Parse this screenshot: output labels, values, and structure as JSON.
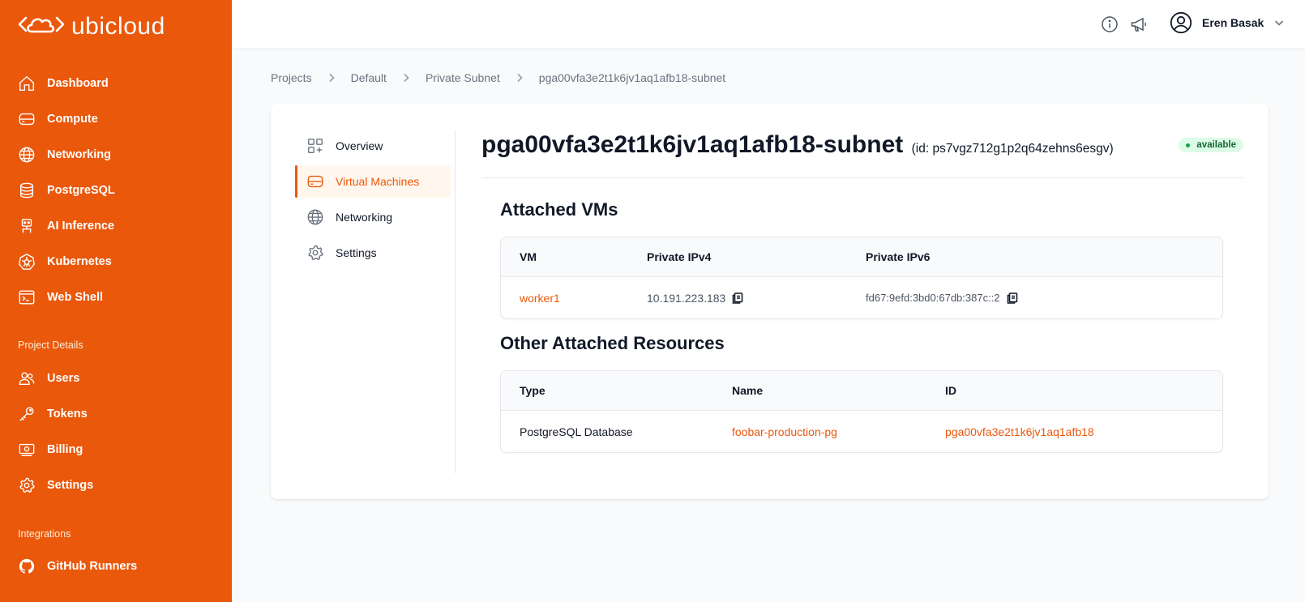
{
  "app": {
    "brand": "ubicloud",
    "accent_color": "#ea580c"
  },
  "sidebar": {
    "items": [
      {
        "label": "Dashboard",
        "icon": "home-icon"
      },
      {
        "label": "Compute",
        "icon": "server-icon"
      },
      {
        "label": "Networking",
        "icon": "globe-icon"
      },
      {
        "label": "PostgreSQL",
        "icon": "database-icon"
      },
      {
        "label": "AI Inference",
        "icon": "robot-icon"
      },
      {
        "label": "Kubernetes",
        "icon": "kubernetes-icon"
      },
      {
        "label": "Web Shell",
        "icon": "terminal-icon"
      }
    ],
    "project_section": "Project Details",
    "project_items": [
      {
        "label": "Users",
        "icon": "users-icon"
      },
      {
        "label": "Tokens",
        "icon": "key-icon"
      },
      {
        "label": "Billing",
        "icon": "billing-icon"
      },
      {
        "label": "Settings",
        "icon": "gear-icon"
      }
    ],
    "integrations_section": "Integrations",
    "integration_items": [
      {
        "label": "GitHub Runners",
        "icon": "github-icon"
      }
    ]
  },
  "topbar": {
    "user_name": "Eren Basak"
  },
  "breadcrumb": [
    "Projects",
    "Default",
    "Private Subnet",
    "pga00vfa3e2t1k6jv1aq1afb18-subnet"
  ],
  "sub_nav": [
    {
      "label": "Overview",
      "icon": "overview-icon",
      "active": false
    },
    {
      "label": "Virtual Machines",
      "icon": "server-icon",
      "active": true
    },
    {
      "label": "Networking",
      "icon": "globe-icon",
      "active": false
    },
    {
      "label": "Settings",
      "icon": "gear-icon",
      "active": false
    }
  ],
  "page": {
    "title": "pga00vfa3e2t1k6jv1aq1afb18-subnet",
    "id_text": "(id: ps7vgz712g1p2q64zehns6esgv)",
    "status": "available",
    "status_color": "#16a34a"
  },
  "attached_vms": {
    "title": "Attached VMs",
    "columns": [
      "VM",
      "Private IPv4",
      "Private IPv6"
    ],
    "rows": [
      {
        "vm": "worker1",
        "ipv4": "10.191.223.183",
        "ipv6": "fd67:9efd:3bd0:67db:387c::2"
      }
    ]
  },
  "other_resources": {
    "title": "Other Attached Resources",
    "columns": [
      "Type",
      "Name",
      "ID"
    ],
    "rows": [
      {
        "type": "PostgreSQL Database",
        "name": "foobar-production-pg",
        "id": "pga00vfa3e2t1k6jv1aq1afb18"
      }
    ]
  }
}
